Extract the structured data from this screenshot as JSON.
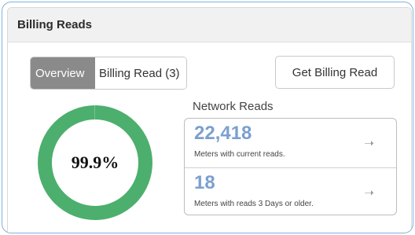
{
  "panel": {
    "title": "Billing Reads"
  },
  "toggle": {
    "overview_label": "Overview",
    "billing_read_label": "Billing Read (3)"
  },
  "get_billing_read_label": "Get Billing Read",
  "donut": {
    "value_text": "99.9%",
    "fraction": 0.999,
    "fill_color": "#4caf6e",
    "track_color": "#ffffff"
  },
  "network": {
    "title": "Network Reads",
    "rows": [
      {
        "value": "22,418",
        "description": "Meters with current reads.",
        "icon": "arrow-right-icon"
      },
      {
        "value": "18",
        "description": "Meters with reads 3 Days or older.",
        "icon": "arrow-right-icon"
      }
    ]
  },
  "colors": {
    "accent": "#7b9fd0",
    "active_segment": "#8a8a8a"
  }
}
